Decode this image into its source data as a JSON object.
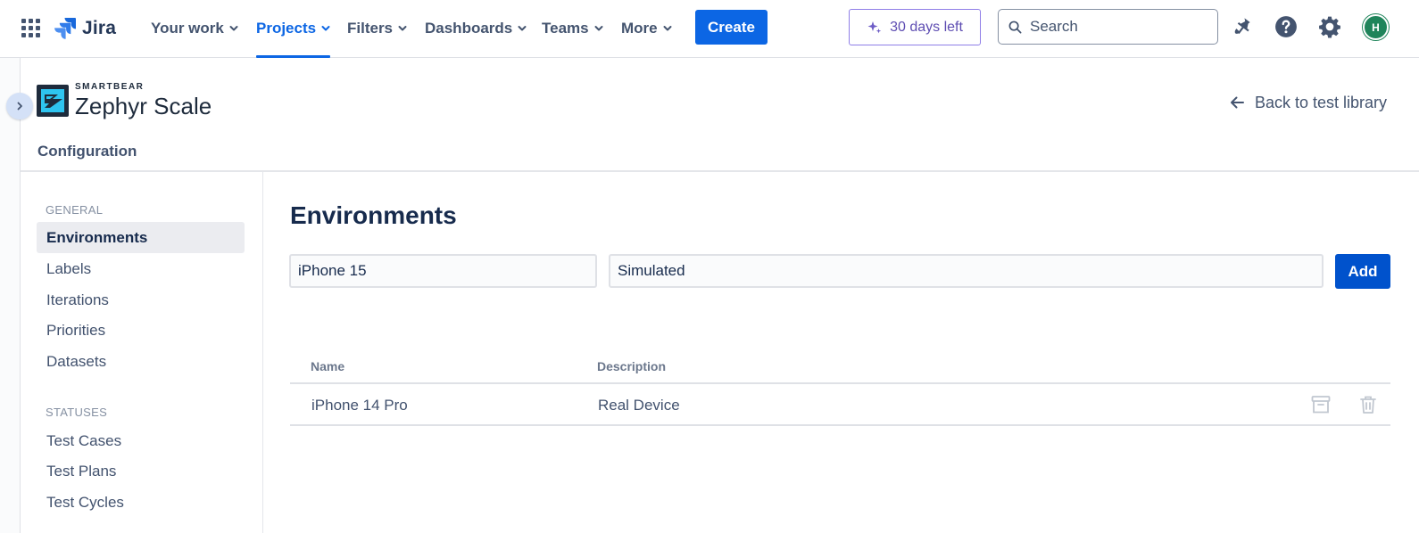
{
  "topnav": {
    "brand": "Jira",
    "items": [
      {
        "label": "Your work"
      },
      {
        "label": "Projects"
      },
      {
        "label": "Filters"
      },
      {
        "label": "Dashboards"
      },
      {
        "label": "Teams"
      },
      {
        "label": "More"
      }
    ],
    "active_item": "Projects",
    "create_label": "Create",
    "trial_label": "30 days left",
    "search_placeholder": "Search",
    "avatar_initial": "H",
    "accent_color": "#0c66e4"
  },
  "app": {
    "brand": "SMARTBEAR",
    "product": "Zephyr Scale",
    "back_label": "Back to test library",
    "page_title": "Configuration"
  },
  "sidebar": {
    "general_label": "GENERAL",
    "general_items": [
      {
        "label": "Environments",
        "active": true
      },
      {
        "label": "Labels"
      },
      {
        "label": "Iterations"
      },
      {
        "label": "Priorities"
      },
      {
        "label": "Datasets"
      }
    ],
    "statuses_label": "STATUSES",
    "statuses_items": [
      {
        "label": "Test Cases"
      },
      {
        "label": "Test Plans"
      },
      {
        "label": "Test Cycles"
      }
    ]
  },
  "main": {
    "heading": "Environments",
    "form": {
      "name_value": "iPhone 15",
      "description_value": "Simulated",
      "add_label": "Add"
    },
    "table": {
      "columns": [
        "Name",
        "Description"
      ],
      "rows": [
        {
          "name": "iPhone 14 Pro",
          "description": "Real Device"
        }
      ]
    }
  },
  "icons": [
    "app-switcher-icon",
    "jira-logo-icon",
    "sparkle-icon",
    "search-icon",
    "notification-icon",
    "help-icon",
    "settings-icon",
    "chevron-right-icon",
    "zephyr-logo-icon",
    "arrow-left-icon",
    "archive-icon",
    "trash-icon"
  ]
}
